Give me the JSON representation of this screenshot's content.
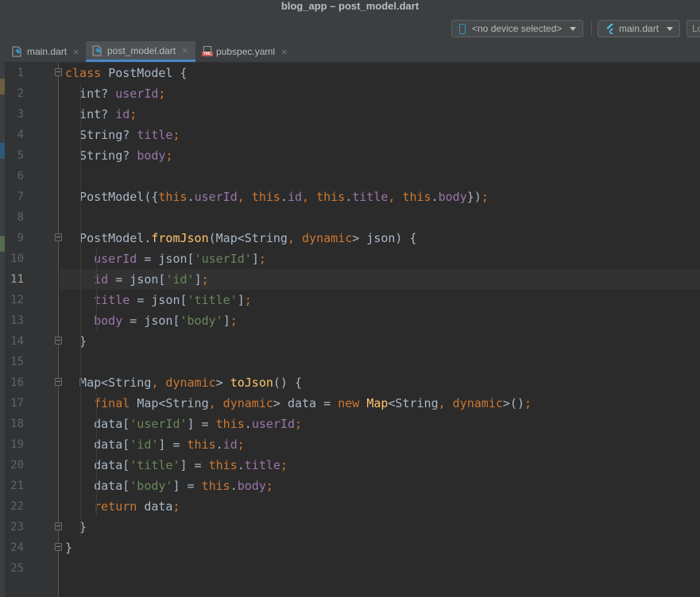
{
  "window": {
    "title": "blog_app – post_model.dart"
  },
  "toolbar": {
    "device": "<no device selected>",
    "config": "main.dart",
    "run_partial": "Lo"
  },
  "tabs": [
    {
      "label": "main.dart",
      "active": false,
      "icon": "dart-file-icon"
    },
    {
      "label": "post_model.dart",
      "active": true,
      "icon": "dart-file-icon"
    },
    {
      "label": "pubspec.yaml",
      "active": false,
      "icon": "yaml-file-icon"
    }
  ],
  "editor": {
    "current_line": 11,
    "line_numbers": [
      "1",
      "2",
      "3",
      "4",
      "5",
      "6",
      "7",
      "8",
      "9",
      "10",
      "11",
      "12",
      "13",
      "14",
      "15",
      "16",
      "17",
      "18",
      "19",
      "20",
      "21",
      "22",
      "23",
      "24",
      "25"
    ],
    "lines": [
      [
        [
          "k",
          "class "
        ],
        [
          "p",
          "PostModel {"
        ]
      ],
      [
        [
          "p",
          "  int? "
        ],
        [
          "f",
          "userId"
        ],
        [
          "k",
          ";"
        ]
      ],
      [
        [
          "p",
          "  int? "
        ],
        [
          "f",
          "id"
        ],
        [
          "k",
          ";"
        ]
      ],
      [
        [
          "p",
          "  String? "
        ],
        [
          "f",
          "title"
        ],
        [
          "k",
          ";"
        ]
      ],
      [
        [
          "p",
          "  String? "
        ],
        [
          "f",
          "body"
        ],
        [
          "k",
          ";"
        ]
      ],
      [],
      [
        [
          "p",
          "  PostModel({"
        ],
        [
          "k",
          "this"
        ],
        [
          "p",
          "."
        ],
        [
          "f",
          "userId"
        ],
        [
          "k",
          ", this"
        ],
        [
          "p",
          "."
        ],
        [
          "f",
          "id"
        ],
        [
          "k",
          ", this"
        ],
        [
          "p",
          "."
        ],
        [
          "f",
          "title"
        ],
        [
          "k",
          ", this"
        ],
        [
          "p",
          "."
        ],
        [
          "f",
          "body"
        ],
        [
          "p",
          "})"
        ],
        [
          "k",
          ";"
        ]
      ],
      [],
      [
        [
          "p",
          "  PostModel."
        ],
        [
          "fn",
          "fromJson"
        ],
        [
          "p",
          "(Map<String"
        ],
        [
          "k",
          ", dynamic"
        ],
        [
          "p",
          "> json) {"
        ]
      ],
      [
        [
          "p",
          "    "
        ],
        [
          "f",
          "userId "
        ],
        [
          "p",
          "= json["
        ],
        [
          "s",
          "'userId'"
        ],
        [
          "p",
          "]"
        ],
        [
          "k",
          ";"
        ]
      ],
      [
        [
          "p",
          "    "
        ],
        [
          "f",
          "id "
        ],
        [
          "p",
          "= json["
        ],
        [
          "s",
          "'id'"
        ],
        [
          "p",
          "]"
        ],
        [
          "k",
          ";"
        ]
      ],
      [
        [
          "p",
          "    "
        ],
        [
          "f",
          "title "
        ],
        [
          "p",
          "= json["
        ],
        [
          "s",
          "'title'"
        ],
        [
          "p",
          "]"
        ],
        [
          "k",
          ";"
        ]
      ],
      [
        [
          "p",
          "    "
        ],
        [
          "f",
          "body "
        ],
        [
          "p",
          "= json["
        ],
        [
          "s",
          "'body'"
        ],
        [
          "p",
          "]"
        ],
        [
          "k",
          ";"
        ]
      ],
      [
        [
          "p",
          "  }"
        ]
      ],
      [],
      [
        [
          "p",
          "  Map<String"
        ],
        [
          "k",
          ", dynamic"
        ],
        [
          "p",
          "> "
        ],
        [
          "fn",
          "toJson"
        ],
        [
          "p",
          "() {"
        ]
      ],
      [
        [
          "k",
          "    final "
        ],
        [
          "p",
          "Map<String"
        ],
        [
          "k",
          ", dynamic"
        ],
        [
          "p",
          "> data = "
        ],
        [
          "k",
          "new "
        ],
        [
          "fn",
          "Map"
        ],
        [
          "p",
          "<String"
        ],
        [
          "k",
          ", dynamic"
        ],
        [
          "p",
          ">()"
        ],
        [
          "k",
          ";"
        ]
      ],
      [
        [
          "p",
          "    data["
        ],
        [
          "s",
          "'userId'"
        ],
        [
          "p",
          "] = "
        ],
        [
          "k",
          "this"
        ],
        [
          "p",
          "."
        ],
        [
          "f",
          "userId"
        ],
        [
          "k",
          ";"
        ]
      ],
      [
        [
          "p",
          "    data["
        ],
        [
          "s",
          "'id'"
        ],
        [
          "p",
          "] = "
        ],
        [
          "k",
          "this"
        ],
        [
          "p",
          "."
        ],
        [
          "f",
          "id"
        ],
        [
          "k",
          ";"
        ]
      ],
      [
        [
          "p",
          "    data["
        ],
        [
          "s",
          "'title'"
        ],
        [
          "p",
          "] = "
        ],
        [
          "k",
          "this"
        ],
        [
          "p",
          "."
        ],
        [
          "f",
          "title"
        ],
        [
          "k",
          ";"
        ]
      ],
      [
        [
          "p",
          "    data["
        ],
        [
          "s",
          "'body'"
        ],
        [
          "p",
          "] = "
        ],
        [
          "k",
          "this"
        ],
        [
          "p",
          "."
        ],
        [
          "f",
          "body"
        ],
        [
          "k",
          ";"
        ]
      ],
      [
        [
          "k",
          "    return "
        ],
        [
          "p",
          "data"
        ],
        [
          "k",
          ";"
        ]
      ],
      [
        [
          "p",
          "  }"
        ]
      ],
      [
        [
          "p",
          "}"
        ]
      ],
      []
    ]
  }
}
